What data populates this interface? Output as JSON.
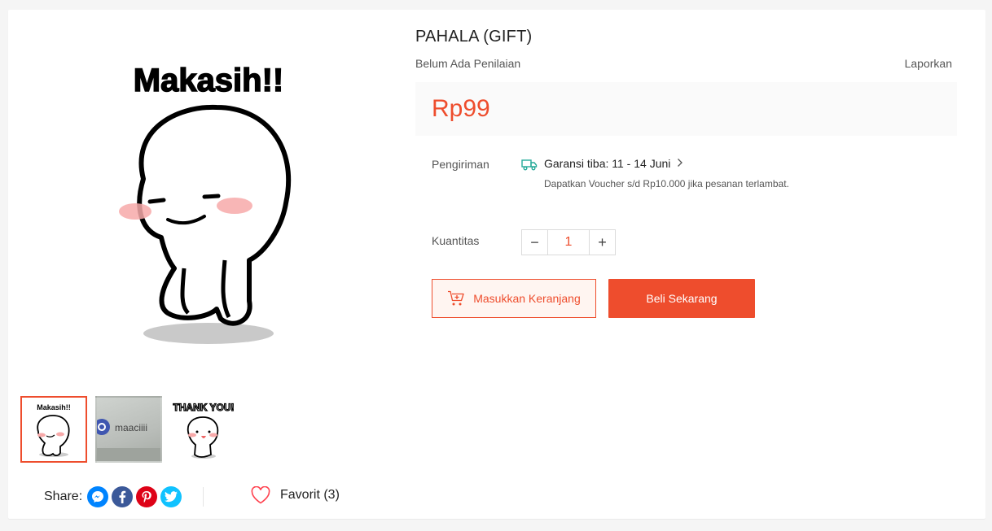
{
  "product": {
    "title": "PAHALA (GIFT)",
    "rating_text": "Belum Ada Penilaian",
    "report_link": "Laporkan",
    "price": "Rp99"
  },
  "gallery": {
    "main_caption": "Makasih!!",
    "thumbnails": [
      {
        "caption": "Makasih!!",
        "active": true
      },
      {
        "caption": "maaciiii",
        "active": false
      },
      {
        "caption": "THANK YOU!",
        "active": false
      }
    ]
  },
  "shipping": {
    "label": "Pengiriman",
    "guarantee": "Garansi tiba: 11 - 14 Juni",
    "voucher_note": "Dapatkan Voucher s/d Rp10.000 jika pesanan terlambat.",
    "icon": "truck-icon",
    "icon_color": "#26aa99"
  },
  "quantity": {
    "label": "Kuantitas",
    "value": "1",
    "decrement_symbol": "−",
    "increment_symbol": "+"
  },
  "actions": {
    "add_to_cart": "Masukkan Keranjang",
    "buy_now": "Beli Sekarang"
  },
  "share": {
    "label": "Share:",
    "networks": [
      "messenger-icon",
      "facebook-icon",
      "pinterest-icon",
      "twitter-icon"
    ]
  },
  "favorite": {
    "label": "Favorit (3)"
  },
  "colors": {
    "accent": "#ee4d2d",
    "messenger": "#0084ff",
    "facebook": "#3b5999",
    "pinterest": "#de0217",
    "twitter": "#10c2ff"
  }
}
